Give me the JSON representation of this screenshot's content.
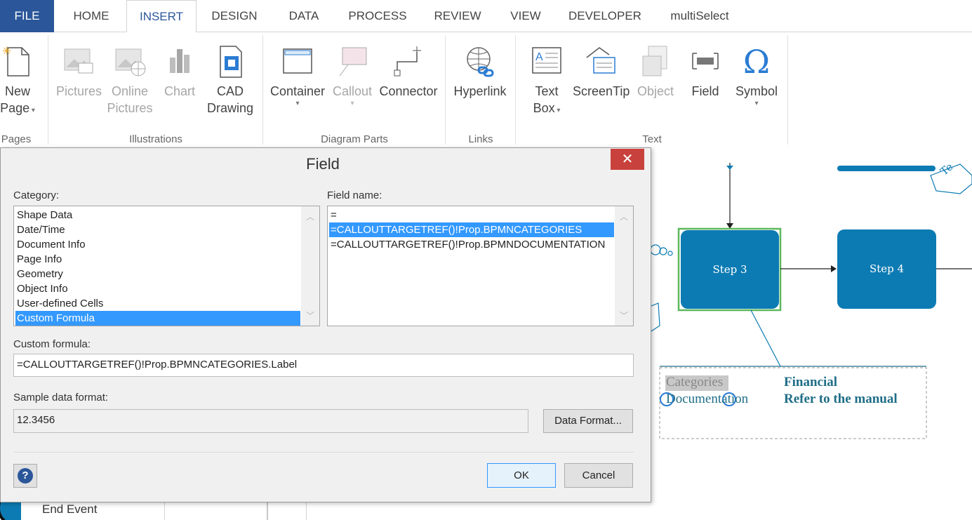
{
  "tabs": [
    "FILE",
    "HOME",
    "INSERT",
    "DESIGN",
    "DATA",
    "PROCESS",
    "REVIEW",
    "VIEW",
    "DEVELOPER",
    "multiSelect"
  ],
  "ribbon": {
    "new_page": {
      "line1": "New",
      "line2": "Page"
    },
    "pictures": "Pictures",
    "online_pictures": {
      "line1": "Online",
      "line2": "Pictures"
    },
    "chart": "Chart",
    "cad_drawing": {
      "line1": "CAD",
      "line2": "Drawing"
    },
    "container": "Container",
    "callout": "Callout",
    "connector": "Connector",
    "hyperlink": "Hyperlink",
    "text_box": {
      "line1": "Text",
      "line2": "Box"
    },
    "screentip": "ScreenTip",
    "object": "Object",
    "field": "Field",
    "symbol": "Symbol",
    "groups": {
      "pages": "Pages",
      "illustrations": "Illustrations",
      "diagram_parts": "Diagram Parts",
      "links": "Links",
      "text": "Text"
    }
  },
  "dialog": {
    "title": "Field",
    "close": "✕",
    "category_label": "Category:",
    "categories": [
      "Shape Data",
      "Date/Time",
      "Document Info",
      "Page Info",
      "Geometry",
      "Object Info",
      "User-defined Cells",
      "Custom Formula"
    ],
    "field_name_label": "Field name:",
    "field_names": [
      "=",
      "=CALLOUTTARGETREF()!Prop.BPMNCATEGORIES",
      "=CALLOUTTARGETREF()!Prop.BPMNDOCUMENTATION"
    ],
    "custom_formula_label": "Custom formula:",
    "custom_formula_value": "=CALLOUTTARGETREF()!Prop.BPMNCATEGORIES.Label",
    "sample_label": "Sample data format:",
    "sample_value": "12.3456",
    "data_format_button": "Data Format...",
    "ok_button": "OK",
    "cancel_button": "Cancel",
    "help_icon": "?"
  },
  "canvas": {
    "step3": "Step 3",
    "step4": "Step 4",
    "callout_categories": "Categories",
    "callout_documentation": "Documentation",
    "callout_financial": "Financial",
    "callout_refer": "Refer to the manual",
    "corner_text": "Te"
  },
  "shapes_panel": {
    "end_event": "End Event"
  },
  "colors": {
    "file_tab": "#2b579a",
    "accent": "#2b579a",
    "step_fill": "#0c7bb3",
    "selection": "#3399ff",
    "close_button": "#c9413c",
    "callout_text": "#1f6e87"
  }
}
